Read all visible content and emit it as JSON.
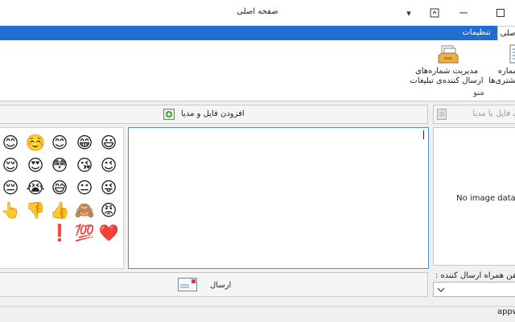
{
  "window": {
    "title": "صفحه اصلی"
  },
  "ribbon": {
    "tabs": [
      {
        "label": "اصلی"
      },
      {
        "label": "تنظیمات"
      }
    ],
    "buttons": [
      {
        "label_line1": "مدیریت شماره‌های",
        "label_line2": "ارسال کننده‌ی تبلیغات",
        "icon": "inbox-tray-icon"
      },
      {
        "label_line1": "شماره",
        "label_line2": "مشتری‌ها",
        "icon": "document-list-icon"
      }
    ],
    "group_caption": "منو"
  },
  "toolbar": {
    "add_media_label": "افزودن فایل و مدیا",
    "remove_media_label": "حذف فایل یا مدیا",
    "send_label": "ارسال"
  },
  "emoji_palette": {
    "rows": [
      [
        "😃",
        "😁",
        "😊",
        "☺️",
        "😊"
      ],
      [
        "😉",
        "😘",
        "😳",
        "😍",
        "😌"
      ],
      [
        "😜",
        "😐",
        "😅",
        "😭",
        "😔"
      ],
      [
        "😡",
        "🙈",
        "👍",
        "👎",
        "👆"
      ],
      [
        "❤️",
        "💯",
        "❗"
      ]
    ]
  },
  "image_panel": {
    "placeholder": "No image data"
  },
  "sender": {
    "label": "تلفن همراه ارسال کننده :",
    "value": ""
  },
  "status": {
    "text": "appw"
  },
  "colors": {
    "accent": "#1e6fd0",
    "focus_border": "#4a8fd6"
  }
}
